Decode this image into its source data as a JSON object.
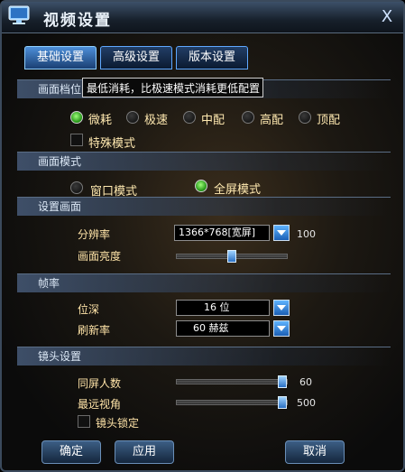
{
  "window": {
    "title": "视频设置",
    "close_glyph": "X"
  },
  "tabs": [
    {
      "label": "基础设置",
      "active": true
    },
    {
      "label": "高级设置",
      "active": false
    },
    {
      "label": "版本设置",
      "active": false
    }
  ],
  "tooltip": "最低消耗，比极速模式消耗更低配置",
  "quality": {
    "section": "画面档位",
    "options": [
      "微耗",
      "极速",
      "中配",
      "高配",
      "顶配"
    ],
    "selected": "微耗",
    "special_mode": {
      "label": "特殊模式",
      "checked": false
    }
  },
  "display_mode": {
    "section": "画面模式",
    "options": [
      "窗口模式",
      "全屏模式"
    ],
    "selected": "全屏模式"
  },
  "screen": {
    "section": "设置画面",
    "resolution_label": "分辨率",
    "resolution_value": "1366*768[宽屏]",
    "resolution_extra": "100",
    "brightness_label": "画面亮度",
    "brightness_level": 0.5
  },
  "frame": {
    "section": "帧率",
    "depth_label": "位深",
    "depth_value": "16  位",
    "refresh_label": "刷新率",
    "refresh_value": "60  赫兹"
  },
  "camera": {
    "section": "镜头设置",
    "same_screen_label": "同屏人数",
    "same_screen_value": "60",
    "same_screen_level": 1.0,
    "view_distance_label": "最远视角",
    "view_distance_value": "500",
    "view_distance_level": 1.0,
    "lock_label": "镜头锁定",
    "lock_checked": false
  },
  "buttons": {
    "ok": "确定",
    "apply": "应用",
    "cancel": "取消"
  },
  "colors": {
    "accent": "#4d8fd9",
    "radio_on": "#3fcf2a",
    "label": "#ffe4a8"
  }
}
